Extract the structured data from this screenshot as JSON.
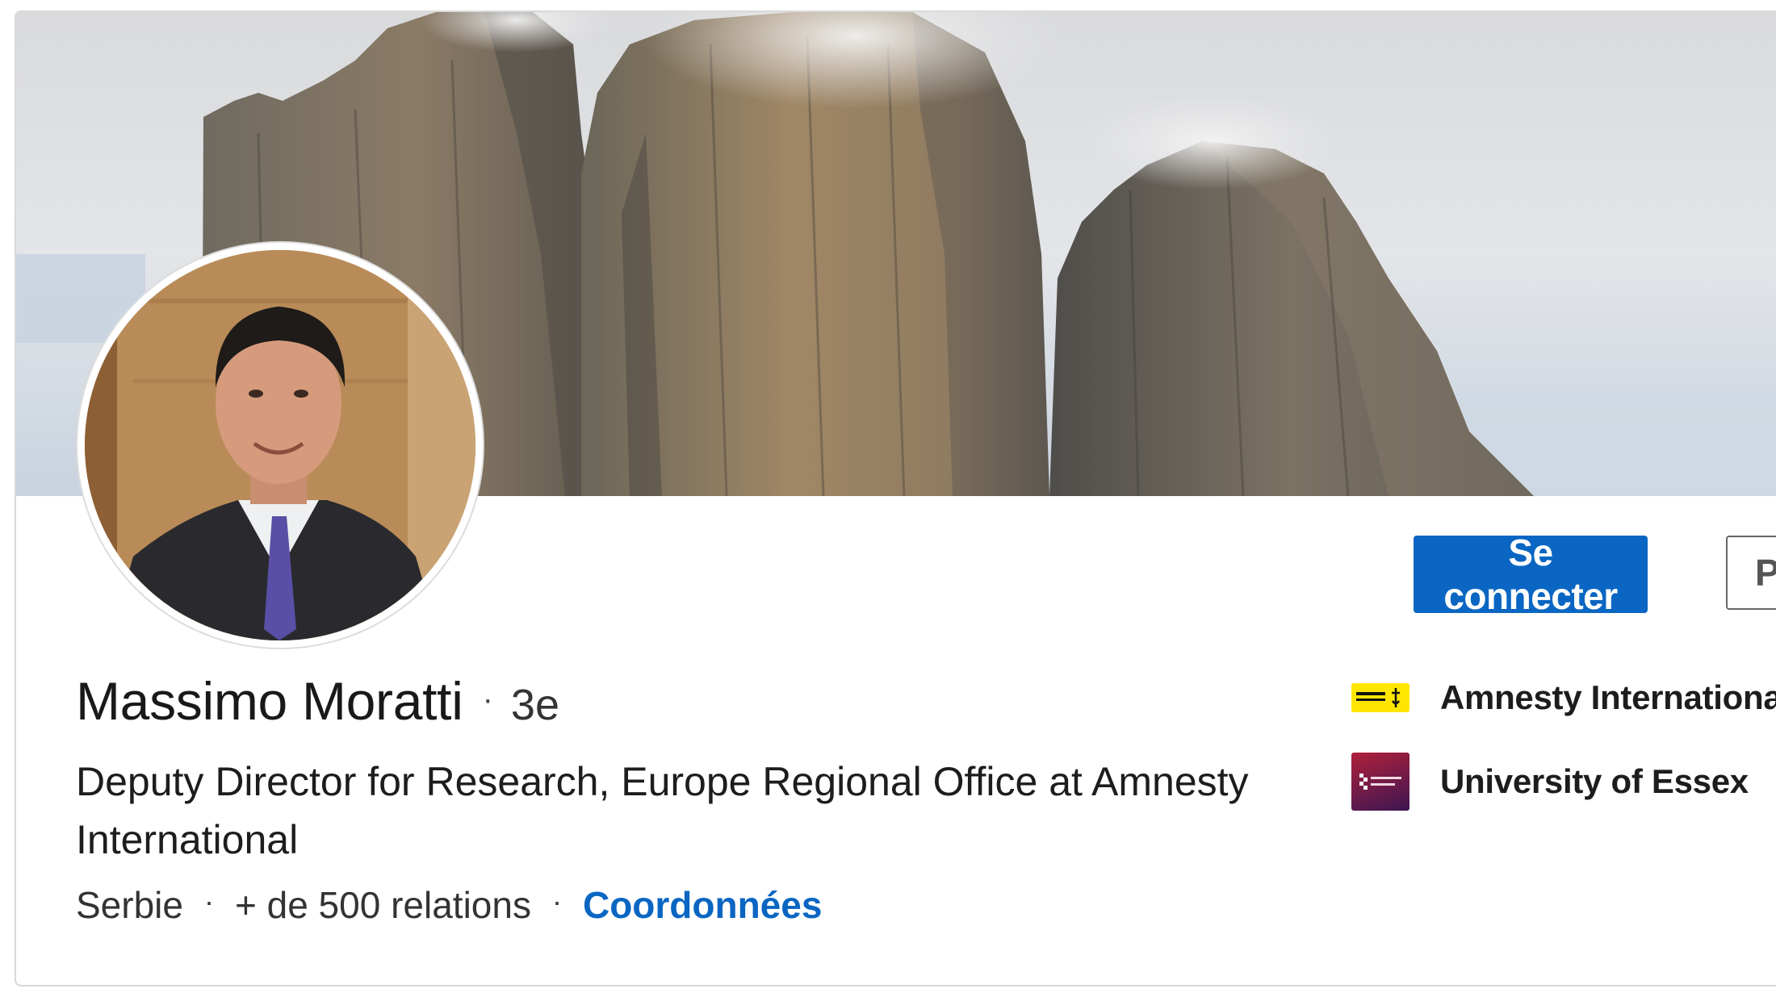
{
  "profile": {
    "name": "Massimo Moratti",
    "degree": "3e",
    "headline": "Deputy Director for Research, Europe Regional Office at Amnesty International",
    "location": "Serbie",
    "connections": "+ de 500 relations",
    "contact_link": "Coordonnées",
    "separator": "·"
  },
  "actions": {
    "connect_label": "Se connecter",
    "more_label_partial": "P"
  },
  "organizations": [
    {
      "name": "Amnesty International",
      "icon": "amnesty-logo-icon",
      "logo_text": "AMNESTY INTERNATIONAL"
    },
    {
      "name": "University of Essex",
      "icon": "essex-logo-icon",
      "logo_text": "University of Essex"
    }
  ],
  "colors": {
    "primary_blue": "#0a66c2",
    "amnesty_yellow": "#ffe600",
    "essex_maroon": "#6a1b4a"
  }
}
